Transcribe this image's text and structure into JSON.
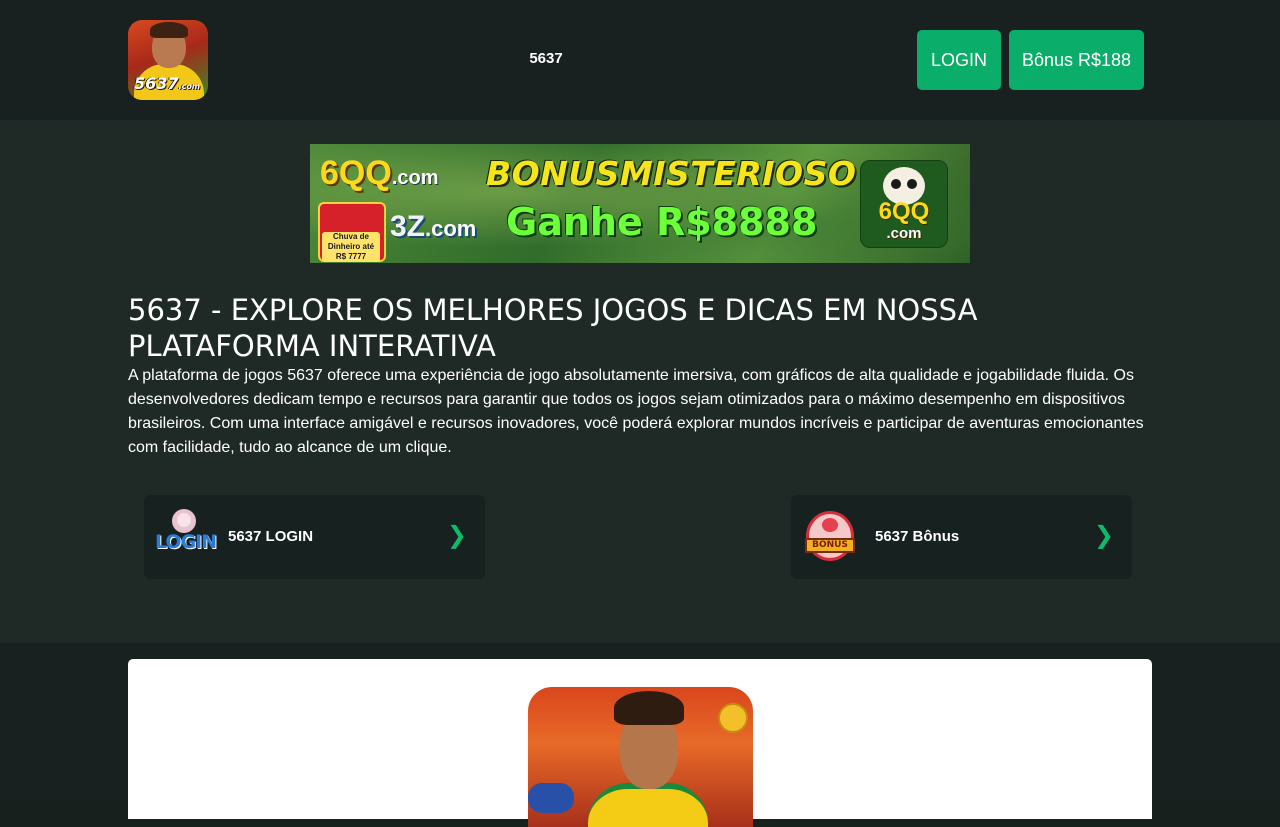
{
  "header": {
    "logo_text": "5637",
    "logo_suffix": ".com",
    "site_title": "5637",
    "login_label": "LOGIN",
    "bonus_label": "Bônus R$188"
  },
  "banner": {
    "brand_6qq": "6QQ",
    "brand_6qq_suffix": ".com",
    "brand_3z": "3Z",
    "brand_3z_suffix": ".com",
    "gift_text": "Chuva de Dinheiro até R$ 7777",
    "headline": "BONUSMISTERIOSO",
    "subheadline": "Ganhe R$8888",
    "badge_top": "6QQ",
    "badge_bottom": ".com"
  },
  "content": {
    "title": "5637 - EXPLORE OS MELHORES JOGOS E DICAS EM NOSSA PLATAFORMA INTERATIVA",
    "intro": "A plataforma de jogos 5637 oferece uma experiência de jogo absolutamente imersiva, com gráficos de alta qualidade e jogabilidade fluida. Os desenvolvedores dedicam tempo e recursos para garantir que todos os jogos sejam otimizados para o máximo desempenho em dispositivos brasileiros. Com uma interface amigável e recursos inovadores, você poderá explorar mundos incríveis e participar de aventuras emocionantes com facilidade, tudo ao alcance de um clique."
  },
  "cards": [
    {
      "icon": "login-icon",
      "icon_text": "LOGIN",
      "label": "5637 LOGIN",
      "chevron": "❯"
    },
    {
      "icon": "bonus-icon",
      "icon_text": "BONUS",
      "label": "5637 Bônus",
      "chevron": "❯"
    }
  ],
  "colors": {
    "accent_green": "#0bad6a",
    "header_bg": "#182020",
    "main_bg": "#1f2a27",
    "card_bg": "#172120"
  }
}
